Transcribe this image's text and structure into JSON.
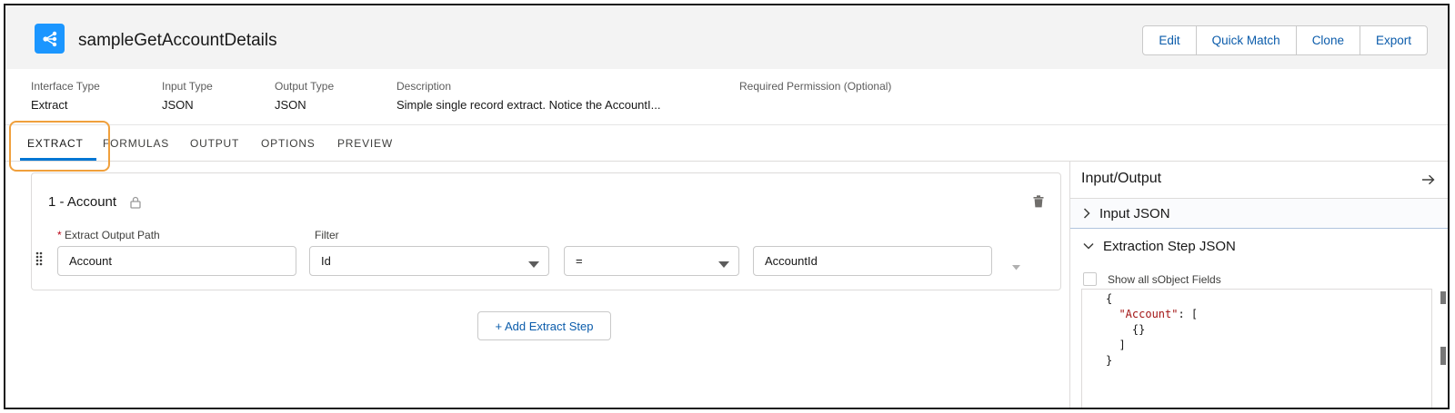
{
  "header": {
    "title": "sampleGetAccountDetails",
    "app_icon": "data-mapper-icon",
    "buttons": [
      "Edit",
      "Quick Match",
      "Clone",
      "Export"
    ]
  },
  "meta": {
    "interface_type": {
      "label": "Interface Type",
      "value": "Extract"
    },
    "input_type": {
      "label": "Input Type",
      "value": "JSON"
    },
    "output_type": {
      "label": "Output Type",
      "value": "JSON"
    },
    "description": {
      "label": "Description",
      "value": "Simple single record extract. Notice the AccountI..."
    },
    "permission": {
      "label": "Required Permission (Optional)",
      "value": ""
    }
  },
  "tabs": {
    "items": [
      "EXTRACT",
      "FORMULAS",
      "OUTPUT",
      "OPTIONS",
      "PREVIEW"
    ],
    "active": "EXTRACT"
  },
  "step": {
    "title": "1 - Account",
    "output_path_label": "Extract Output Path",
    "filter_label": "Filter",
    "output_path_value": "Account",
    "filter_field": "Id",
    "filter_operator": "=",
    "filter_value": "AccountId"
  },
  "add_step_label": "+ Add Extract Step",
  "io_panel": {
    "title": "Input/Output",
    "input_json_label": "Input JSON",
    "extraction_step_label": "Extraction Step JSON",
    "show_all_label": "Show all sObject Fields",
    "json_lines": [
      "{",
      "  \"Account\": [",
      "    {}",
      "  ]",
      "}"
    ]
  },
  "colors": {
    "accent": "#0176d3",
    "link": "#0b5cab",
    "highlight": "#f0a03c",
    "app_icon_bg": "#1b96ff"
  }
}
